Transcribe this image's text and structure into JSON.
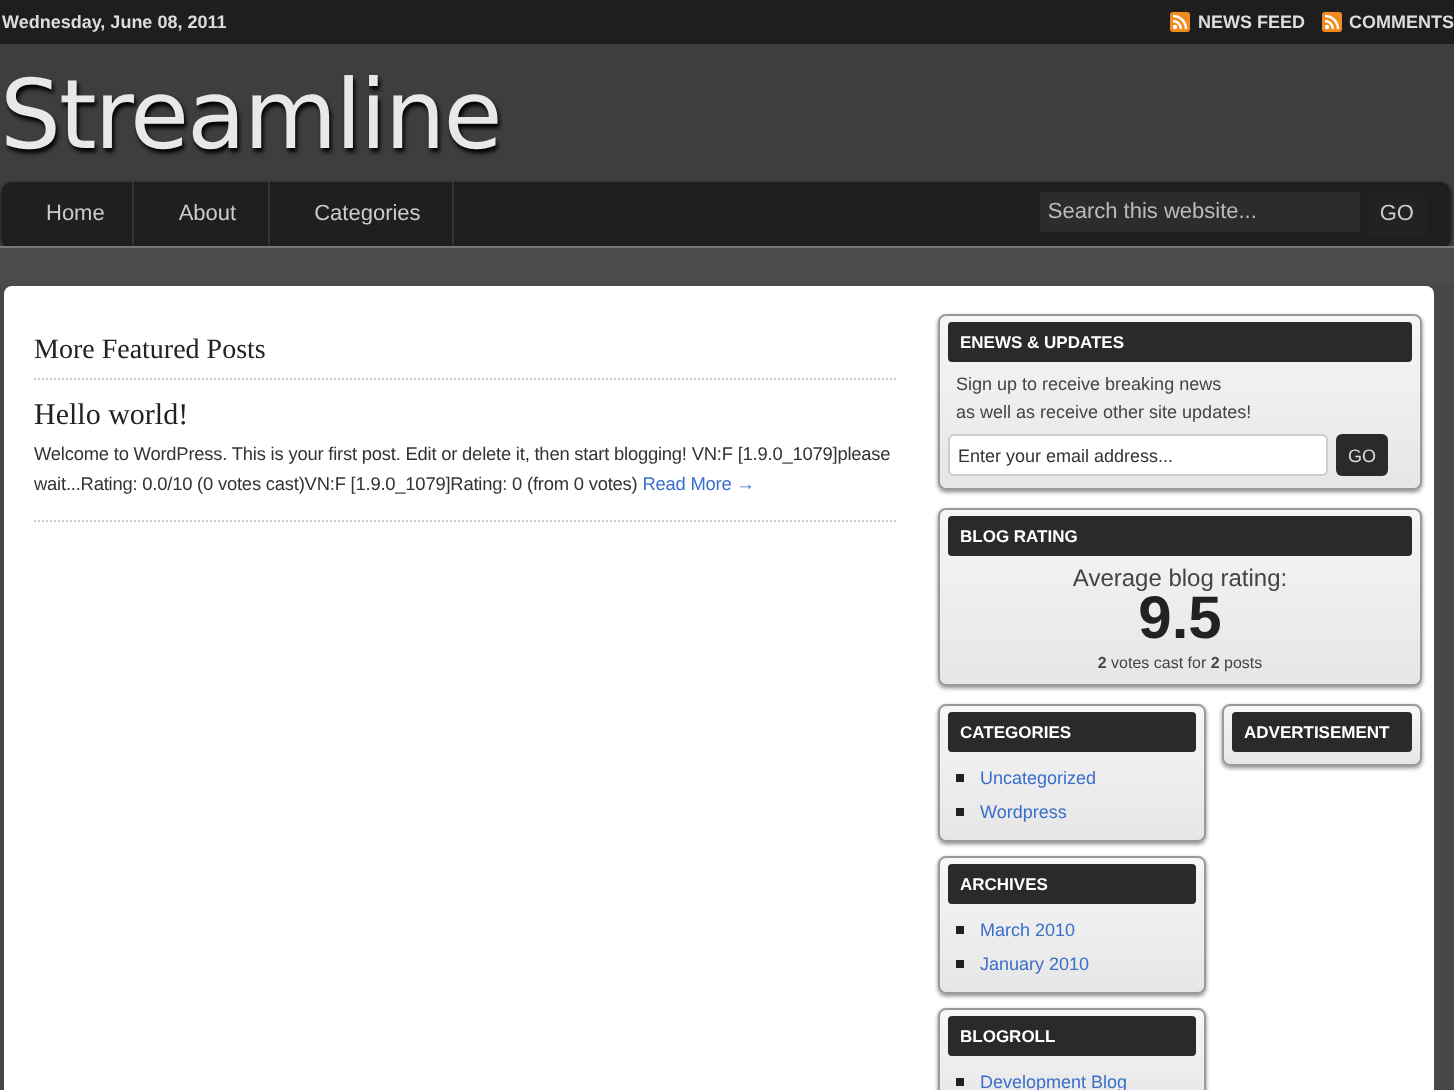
{
  "top_bar": {
    "date": "Wednesday, June 08, 2011",
    "links": [
      "NEWS FEED",
      "COMMENTS"
    ]
  },
  "header": {
    "logo": "Streamline"
  },
  "nav": {
    "items": [
      "Home",
      "About",
      "Categories"
    ],
    "search": {
      "placeholder": "Search this website...",
      "button": "GO"
    }
  },
  "main": {
    "section_title": "More Featured Posts",
    "posts": [
      {
        "title": "Hello world!",
        "excerpt": "Welcome to WordPress. This is your first post. Edit or delete it, then start blogging! VN:F [1.9.0_1079]please wait...Rating: 0.0/10 (0 votes cast)VN:F [1.9.0_1079]Rating: 0 (from 0 votes)",
        "link": "Read More →"
      }
    ]
  },
  "sidebar": {
    "enews": {
      "title": "ENEWS & UPDATES",
      "text_lines": [
        "Sign up to receive breaking news",
        "as well as receive other site updates!"
      ],
      "placeholder": "Enter your email address...",
      "button": "GO"
    },
    "rating": {
      "title": "BLOG RATING",
      "label": "Average blog rating:",
      "value": "9.5",
      "summary": "**2** votes cast for **2** posts"
    },
    "left_widgets": [
      {
        "title": "CATEGORIES",
        "items": [
          "Uncategorized",
          "Wordpress"
        ]
      },
      {
        "title": "ARCHIVES",
        "items": [
          "March 2010",
          "January 2010"
        ]
      },
      {
        "title": "BLOGROLL",
        "items": [
          "Development Blog"
        ]
      }
    ],
    "right_widgets": [
      {
        "title": "ADVERTISEMENT"
      }
    ]
  }
}
